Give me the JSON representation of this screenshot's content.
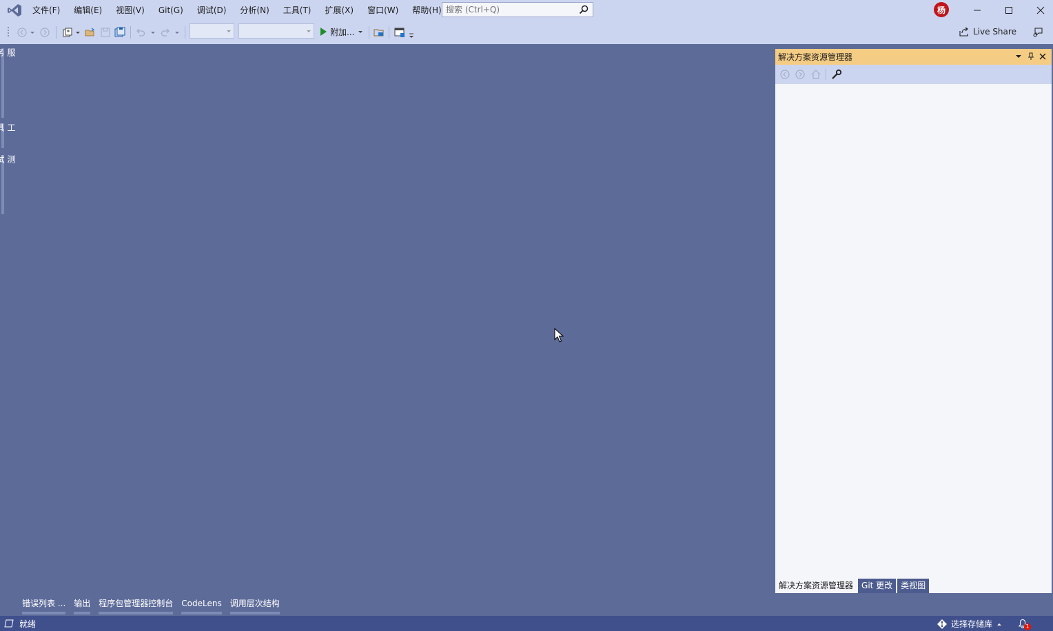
{
  "menu": {
    "items": [
      "文件(F)",
      "编辑(E)",
      "视图(V)",
      "Git(G)",
      "调试(D)",
      "分析(N)",
      "工具(T)",
      "扩展(X)",
      "窗口(W)",
      "帮助(H)"
    ]
  },
  "search": {
    "placeholder": "搜索 (Ctrl+Q)"
  },
  "account": {
    "avatar_text": "杨"
  },
  "toolbar": {
    "attach_label": "附加...",
    "live_share_label": "Live Share"
  },
  "left_tabs": [
    "服务器资源管理器",
    "工具箱",
    "测试资源管理器"
  ],
  "solution_explorer": {
    "title": "解决方案资源管理器",
    "tabs": [
      "解决方案资源管理器",
      "Git 更改",
      "类视图"
    ]
  },
  "bottom_tabs": [
    "错误列表 ...",
    "输出",
    "程序包管理器控制台",
    "CodeLens",
    "调用层次结构"
  ],
  "status": {
    "text": "就绪",
    "repo_label": "选择存储库",
    "notifications": "1"
  },
  "colors": {
    "chrome": "#ccd5f0",
    "workspace": "#5d6b99",
    "panel_header": "#f5cc84",
    "statusbar": "#40508d",
    "avatar": "#c0161b"
  }
}
